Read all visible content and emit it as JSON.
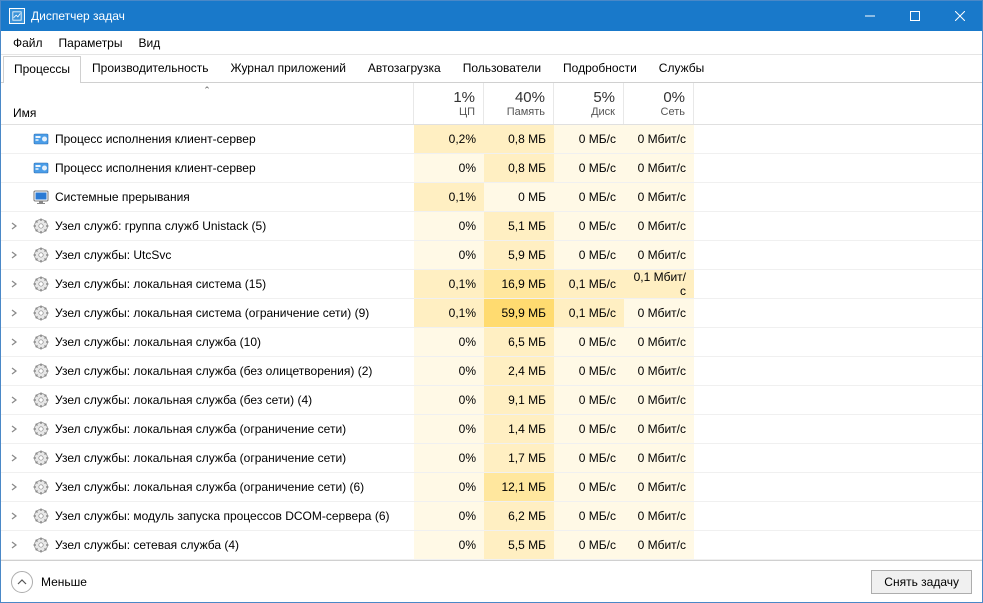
{
  "title": "Диспетчер задач",
  "menu": {
    "file": "Файл",
    "options": "Параметры",
    "view": "Вид"
  },
  "tabs": {
    "processes": "Процессы",
    "performance": "Производительность",
    "app_history": "Журнал приложений",
    "startup": "Автозагрузка",
    "users": "Пользователи",
    "details": "Подробности",
    "services": "Службы"
  },
  "columns": {
    "name": "Имя",
    "cpu": {
      "pct": "1%",
      "label": "ЦП"
    },
    "mem": {
      "pct": "40%",
      "label": "Память"
    },
    "disk": {
      "pct": "5%",
      "label": "Диск"
    },
    "net": {
      "pct": "0%",
      "label": "Сеть"
    }
  },
  "rows": [
    {
      "icon": "cs",
      "expand": false,
      "name": "Процесс исполнения клиент-сервер",
      "cpu": "0,2%",
      "mem": "0,8 МБ",
      "disk": "0 МБ/с",
      "net": "0 Мбит/с",
      "cpu_h": 1,
      "mem_h": 1,
      "disk_h": 0,
      "net_h": 0
    },
    {
      "icon": "cs",
      "expand": false,
      "name": "Процесс исполнения клиент-сервер",
      "cpu": "0%",
      "mem": "0,8 МБ",
      "disk": "0 МБ/с",
      "net": "0 Мбит/с",
      "cpu_h": 0,
      "mem_h": 1,
      "disk_h": 0,
      "net_h": 0
    },
    {
      "icon": "sys",
      "expand": false,
      "name": "Системные прерывания",
      "cpu": "0,1%",
      "mem": "0 МБ",
      "disk": "0 МБ/с",
      "net": "0 Мбит/с",
      "cpu_h": 1,
      "mem_h": 0,
      "disk_h": 0,
      "net_h": 0
    },
    {
      "icon": "gear",
      "expand": true,
      "name": "Узел служб: группа служб Unistack (5)",
      "cpu": "0%",
      "mem": "5,1 МБ",
      "disk": "0 МБ/с",
      "net": "0 Мбит/с",
      "cpu_h": 0,
      "mem_h": 1,
      "disk_h": 0,
      "net_h": 0
    },
    {
      "icon": "gear",
      "expand": true,
      "name": "Узел службы: UtcSvc",
      "cpu": "0%",
      "mem": "5,9 МБ",
      "disk": "0 МБ/с",
      "net": "0 Мбит/с",
      "cpu_h": 0,
      "mem_h": 1,
      "disk_h": 0,
      "net_h": 0
    },
    {
      "icon": "gear",
      "expand": true,
      "name": "Узел службы: локальная система (15)",
      "cpu": "0,1%",
      "mem": "16,9 МБ",
      "disk": "0,1 МБ/с",
      "net": "0,1 Мбит/с",
      "cpu_h": 1,
      "mem_h": 2,
      "disk_h": 1,
      "net_h": 1
    },
    {
      "icon": "gear",
      "expand": true,
      "name": "Узел службы: локальная система (ограничение сети) (9)",
      "cpu": "0,1%",
      "mem": "59,9 МБ",
      "disk": "0,1 МБ/с",
      "net": "0 Мбит/с",
      "cpu_h": 1,
      "mem_h": 3,
      "disk_h": 1,
      "net_h": 0
    },
    {
      "icon": "gear",
      "expand": true,
      "name": "Узел службы: локальная служба (10)",
      "cpu": "0%",
      "mem": "6,5 МБ",
      "disk": "0 МБ/с",
      "net": "0 Мбит/с",
      "cpu_h": 0,
      "mem_h": 1,
      "disk_h": 0,
      "net_h": 0
    },
    {
      "icon": "gear",
      "expand": true,
      "name": "Узел службы: локальная служба (без олицетворения) (2)",
      "cpu": "0%",
      "mem": "2,4 МБ",
      "disk": "0 МБ/с",
      "net": "0 Мбит/с",
      "cpu_h": 0,
      "mem_h": 1,
      "disk_h": 0,
      "net_h": 0
    },
    {
      "icon": "gear",
      "expand": true,
      "name": "Узел службы: локальная служба (без сети) (4)",
      "cpu": "0%",
      "mem": "9,1 МБ",
      "disk": "0 МБ/с",
      "net": "0 Мбит/с",
      "cpu_h": 0,
      "mem_h": 1,
      "disk_h": 0,
      "net_h": 0
    },
    {
      "icon": "gear",
      "expand": true,
      "name": "Узел службы: локальная служба (ограничение сети)",
      "cpu": "0%",
      "mem": "1,4 МБ",
      "disk": "0 МБ/с",
      "net": "0 Мбит/с",
      "cpu_h": 0,
      "mem_h": 1,
      "disk_h": 0,
      "net_h": 0
    },
    {
      "icon": "gear",
      "expand": true,
      "name": "Узел службы: локальная служба (ограничение сети)",
      "cpu": "0%",
      "mem": "1,7 МБ",
      "disk": "0 МБ/с",
      "net": "0 Мбит/с",
      "cpu_h": 0,
      "mem_h": 1,
      "disk_h": 0,
      "net_h": 0
    },
    {
      "icon": "gear",
      "expand": true,
      "name": "Узел службы: локальная служба (ограничение сети) (6)",
      "cpu": "0%",
      "mem": "12,1 МБ",
      "disk": "0 МБ/с",
      "net": "0 Мбит/с",
      "cpu_h": 0,
      "mem_h": 2,
      "disk_h": 0,
      "net_h": 0
    },
    {
      "icon": "gear",
      "expand": true,
      "name": "Узел службы: модуль запуска процессов DCOM-сервера (6)",
      "cpu": "0%",
      "mem": "6,2 МБ",
      "disk": "0 МБ/с",
      "net": "0 Мбит/с",
      "cpu_h": 0,
      "mem_h": 1,
      "disk_h": 0,
      "net_h": 0
    },
    {
      "icon": "gear",
      "expand": true,
      "name": "Узел службы: сетевая служба (4)",
      "cpu": "0%",
      "mem": "5,5 МБ",
      "disk": "0 МБ/с",
      "net": "0 Мбит/с",
      "cpu_h": 0,
      "mem_h": 1,
      "disk_h": 0,
      "net_h": 0
    }
  ],
  "footer": {
    "fewer": "Меньше",
    "end_task": "Снять задачу"
  }
}
